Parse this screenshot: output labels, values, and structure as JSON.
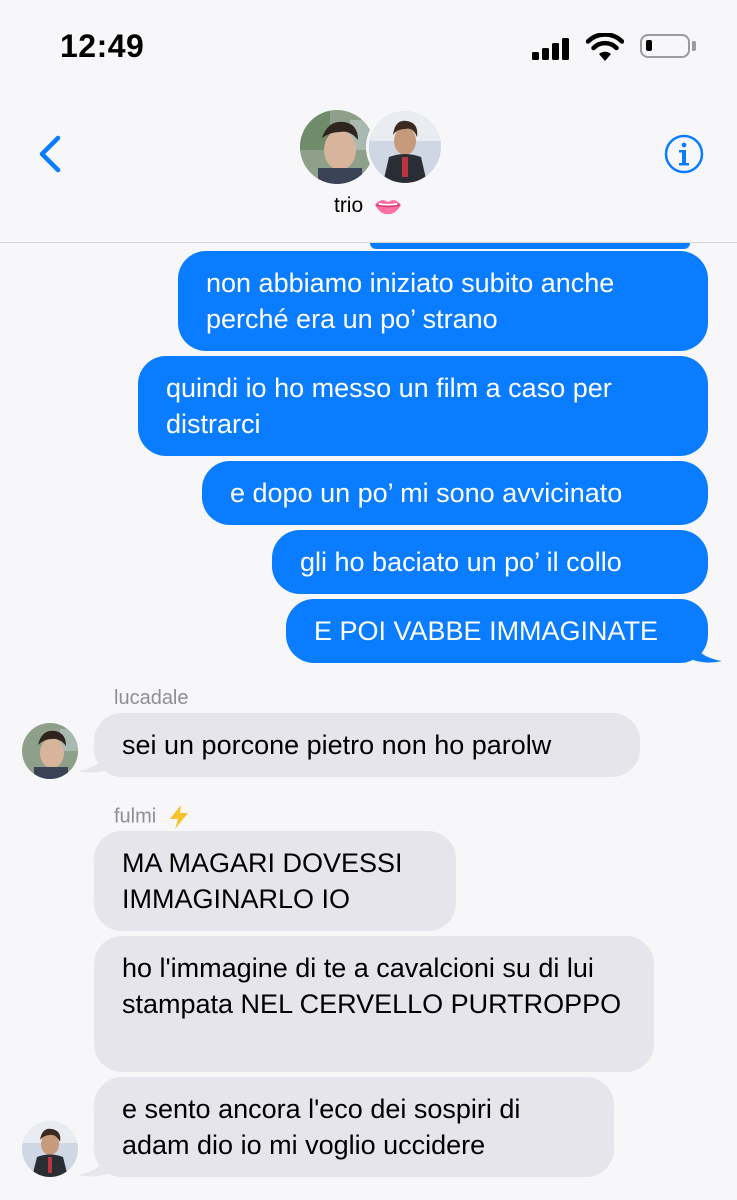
{
  "status_bar": {
    "time": "12:49"
  },
  "header": {
    "group_name": "trio",
    "group_emoji_icon": "lips-icon",
    "back_icon": "chevron-left-icon",
    "info_icon": "info-icon"
  },
  "messages": [
    {
      "direction": "outgoing",
      "text": "non abbiamo iniziato subito anche perché era un po’ strano"
    },
    {
      "direction": "outgoing",
      "text": "quindi io ho messo un film a caso per distrarci"
    },
    {
      "direction": "outgoing",
      "text": "e dopo un po’ mi sono avvicinato"
    },
    {
      "direction": "outgoing",
      "text": "gli ho baciato un po’ il collo"
    },
    {
      "direction": "outgoing",
      "text": "E POI VABBE IMMAGINATE"
    },
    {
      "direction": "incoming",
      "sender": "lucadale",
      "text": "sei un porcone pietro non ho parolw"
    },
    {
      "direction": "incoming",
      "sender": "fulmi",
      "sender_emoji_icon": "lightning-icon",
      "text": "MA MAGARI DOVESSI IMMAGINARLO IO"
    },
    {
      "direction": "incoming",
      "text": "ho l'immagine di te a cavalcioni su di lui stampata NEL CERVELLO PURTROPPO"
    },
    {
      "direction": "incoming",
      "text": "e sento ancora l'eco dei sospiri di adam dio io mi voglio uccidere"
    }
  ],
  "colors": {
    "outgoing_bubble": "#0a7cff",
    "incoming_bubble": "#e6e5eb",
    "accent": "#0a7cff",
    "background": "#f7f7f9"
  }
}
